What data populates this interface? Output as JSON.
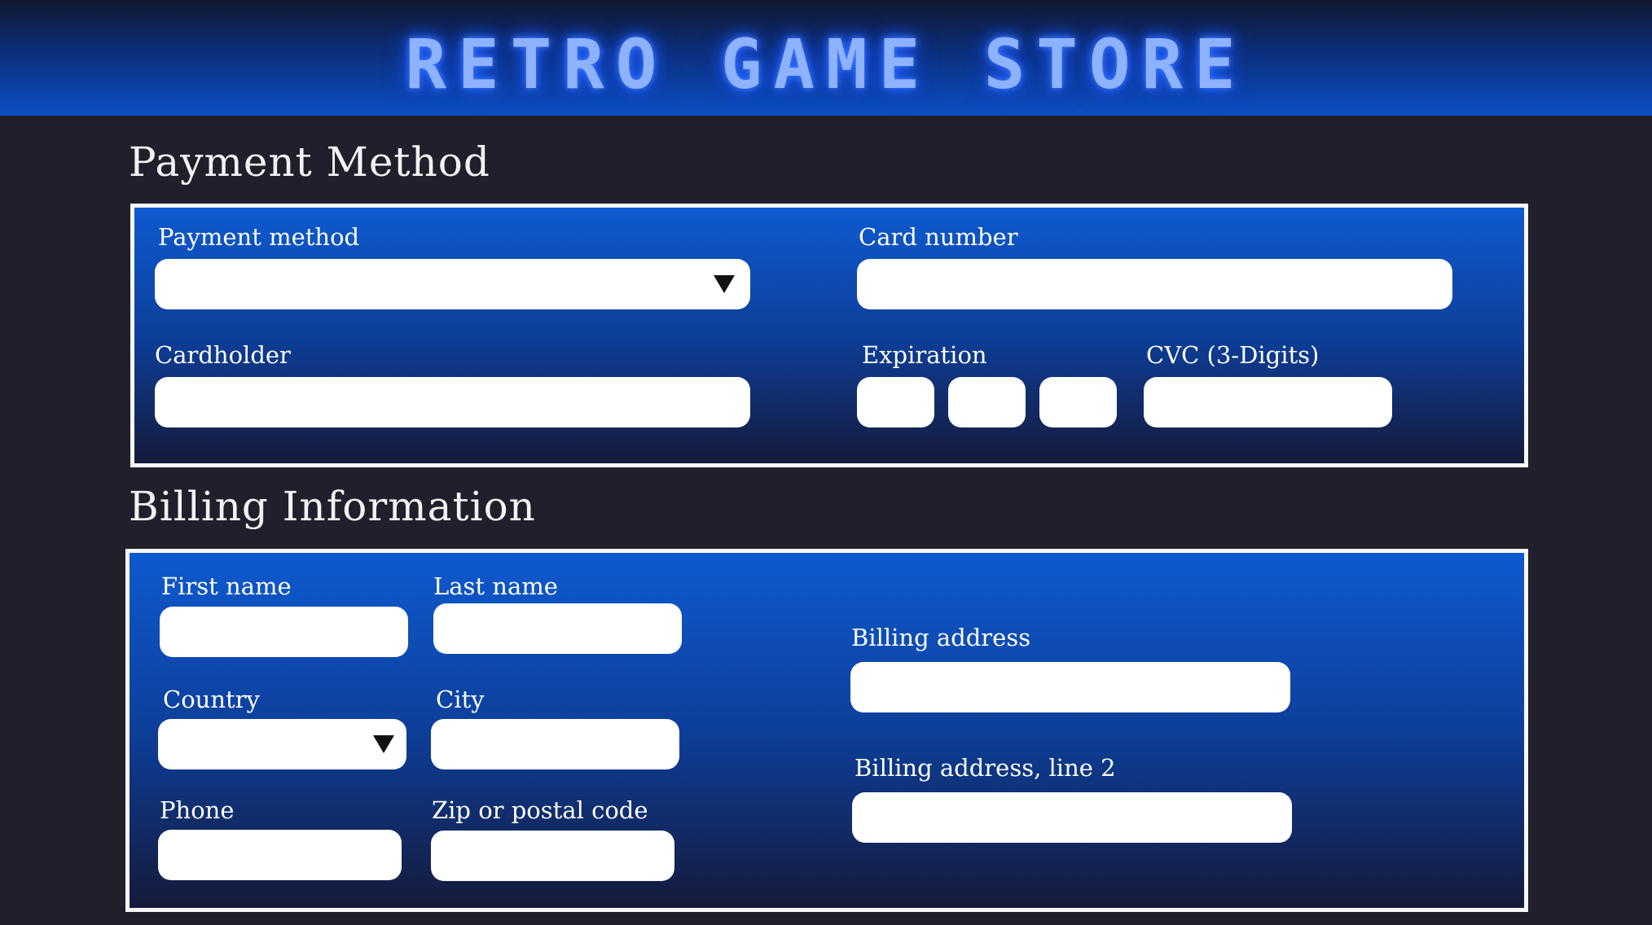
{
  "header": {
    "brand": "RETRO GAME STORE"
  },
  "payment": {
    "title": "Payment Method",
    "method_label": "Payment method",
    "method_value": "",
    "card_number_label": "Card number",
    "cardholder_label": "Cardholder",
    "expiration_label": "Expiration",
    "cvc_label": "CVC (3-Digits)"
  },
  "billing": {
    "title": "Billing Information",
    "first_name_label": "First name",
    "last_name_label": "Last name",
    "country_label": "Country",
    "country_value": "",
    "city_label": "City",
    "phone_label": "Phone",
    "zip_label": "Zip or postal code",
    "address_label": "Billing address",
    "address2_label": "Billing address, line 2"
  },
  "colors": {
    "page_bg": "#201f2b",
    "header_accent": "#0c4fc4",
    "brand_glow": "#8fb2ff",
    "panel_top": "#0e5ad0",
    "panel_bottom": "#151a3b",
    "field_bg": "#ffffff"
  },
  "icons": {
    "dropdown": "chevron-down-icon"
  }
}
